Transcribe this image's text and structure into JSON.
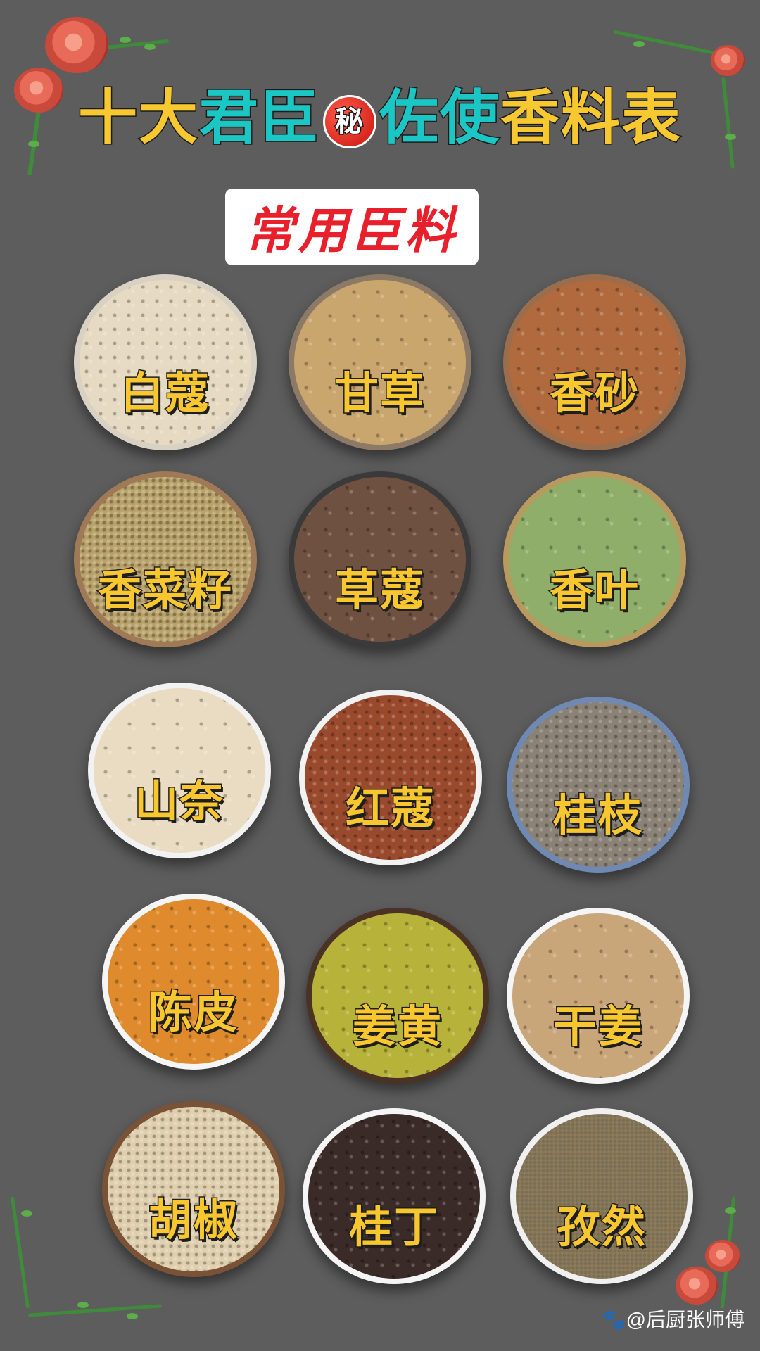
{
  "title": {
    "part1": "十大",
    "part2": "君臣",
    "badge": "秘",
    "part3": "佐使",
    "part4": "香料表"
  },
  "subtitle": "常用臣料",
  "spices": [
    {
      "name": "白蔻",
      "rim": "#d9d2c4",
      "fill": "#e6dbc2",
      "dot": "20px"
    },
    {
      "name": "甘草",
      "rim": "#8c7a66",
      "fill": "#c9a66e",
      "dot": "34px"
    },
    {
      "name": "香砂",
      "rim": "#9a6d4c",
      "fill": "#b06a3e",
      "dot": "28px"
    },
    {
      "name": "香菜籽",
      "rim": "#a07a57",
      "fill": "#b9a16a",
      "dot": "10px"
    },
    {
      "name": "草蔻",
      "rim": "#3a3a3a",
      "fill": "#6e5140",
      "dot": "30px"
    },
    {
      "name": "香叶",
      "rim": "#b89a5e",
      "fill": "#8fae6a",
      "dot": "40px"
    },
    {
      "name": "山奈",
      "rim": "#f2f2f2",
      "fill": "#eadcc3",
      "dot": "34px"
    },
    {
      "name": "红蔻",
      "rim": "#f2f2f2",
      "fill": "#9a4a2c",
      "dot": "16px"
    },
    {
      "name": "桂枝",
      "rim": "#6f89b3",
      "fill": "#8a8276",
      "dot": "14px"
    },
    {
      "name": "陈皮",
      "rim": "#f5f5f5",
      "fill": "#e08a2e",
      "dot": "26px"
    },
    {
      "name": "姜黄",
      "rim": "#4a3324",
      "fill": "#b7b23a",
      "dot": "30px"
    },
    {
      "name": "干姜",
      "rim": "#f5f5f5",
      "fill": "#c9a57a",
      "dot": "36px"
    },
    {
      "name": "胡椒",
      "rim": "#7a5236",
      "fill": "#dfcfae",
      "dot": "12px"
    },
    {
      "name": "桂丁",
      "rim": "#f5f5f5",
      "fill": "#3a2a28",
      "dot": "22px"
    },
    {
      "name": "孜然",
      "rim": "#f0f0f0",
      "fill": "#8f7b55",
      "dot": "6px"
    }
  ],
  "watermark": "@后厨张师傅"
}
